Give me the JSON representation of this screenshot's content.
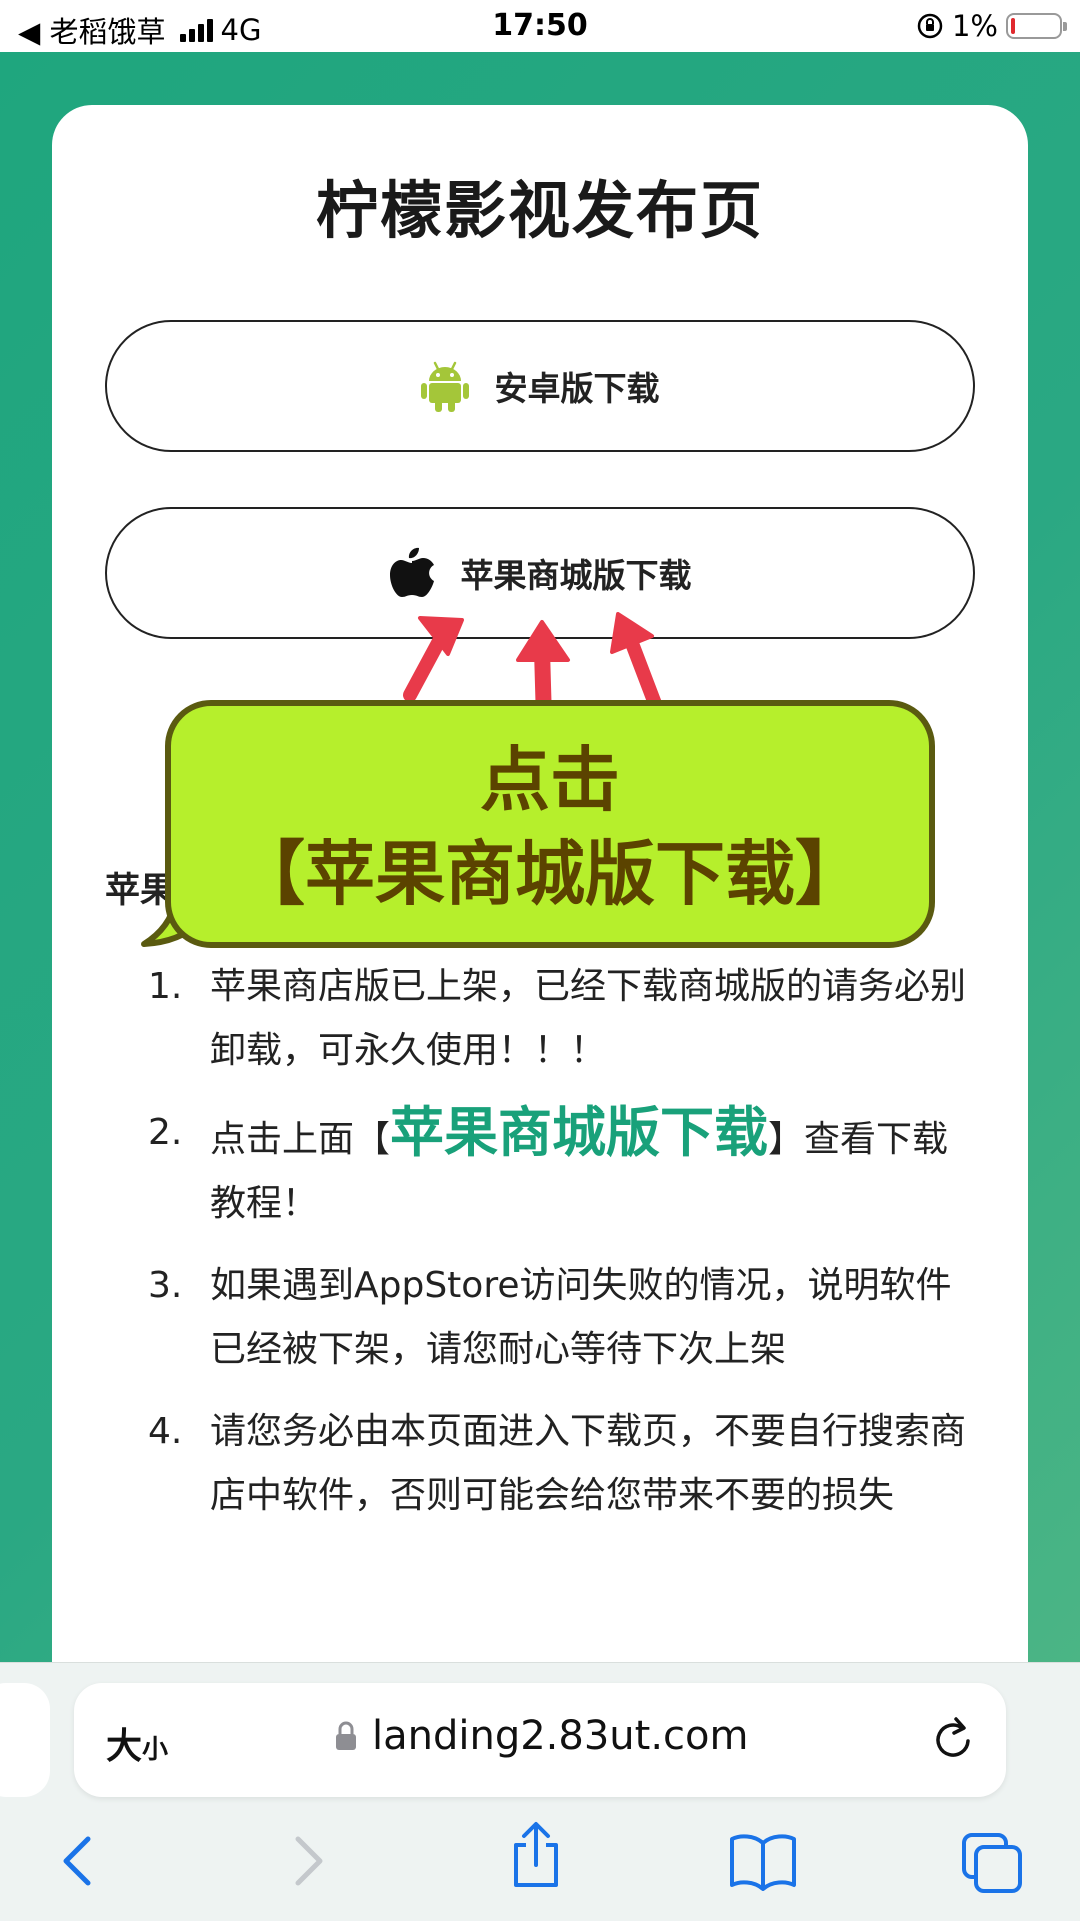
{
  "status_bar": {
    "back_app": "◀ 老稻饿草",
    "network": "4G",
    "time": "17:50",
    "battery_pct": "1%",
    "battery_level": 0.01
  },
  "page": {
    "title": "柠檬影视发布页",
    "android_button": "安卓版下载",
    "apple_button": "苹果商城版下载",
    "list_heading": "苹果",
    "notes": [
      {
        "num": "1.",
        "text": "苹果商店版已上架，已经下载商城版的请务必别卸载，可永久使用！！！"
      },
      {
        "num": "2.",
        "pre": "点击上面【",
        "highlight": "苹果商城版下载",
        "post": "】查看下载教程！"
      },
      {
        "num": "3.",
        "text": "如果遇到AppStore访问失败的情况，说明软件已经被下架，请您耐心等待下次上架"
      },
      {
        "num": "4.",
        "text": "请您务必由本页面进入下载页，不要自行搜索商店中软件，否则可能会给您带来不要的损失"
      }
    ]
  },
  "callout": {
    "line1": "点击",
    "line2": "【苹果商城版下载】"
  },
  "browser": {
    "text_size_label": "大",
    "text_size_small": "小",
    "url": "landing2.83ut.com"
  },
  "colors": {
    "bg_green": "#1fa67e",
    "highlight_green": "#19a17a",
    "callout_fill": "#b6ef2c",
    "android_green": "#a4c639",
    "arrow_red": "#e83a4a",
    "ios_blue": "#1a73e8"
  }
}
